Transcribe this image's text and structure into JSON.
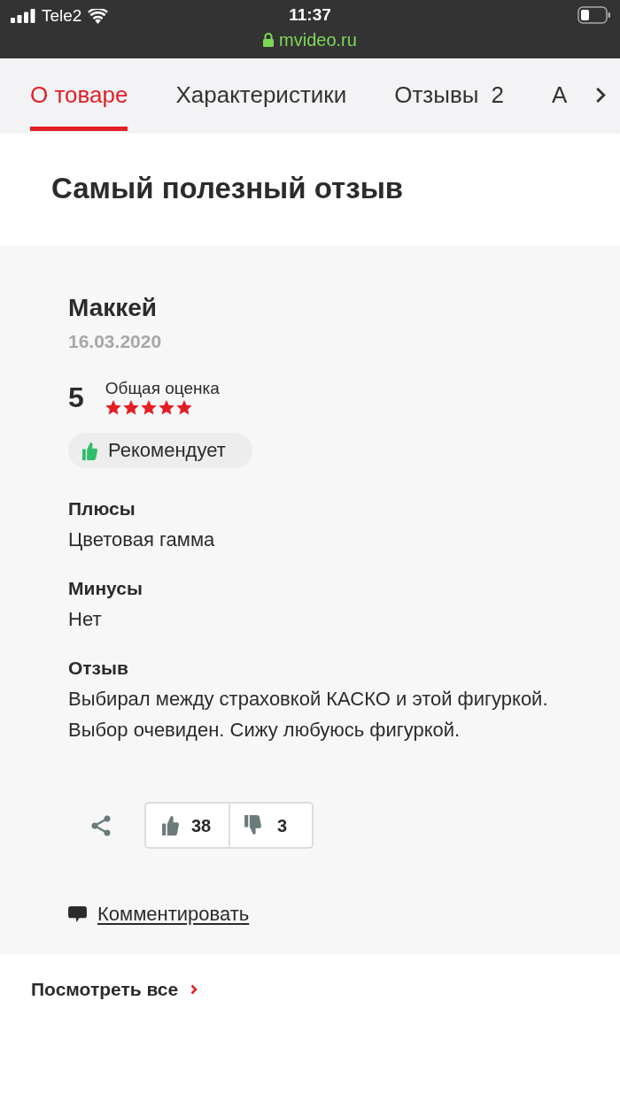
{
  "status_bar": {
    "carrier": "Tele2",
    "time": "11:37",
    "url": "mvideo.ru"
  },
  "tabs": [
    {
      "label": "О товаре",
      "selected": true
    },
    {
      "label": "Характеристики",
      "selected": false
    },
    {
      "label": "Отзывы",
      "count": "2",
      "selected": false
    },
    {
      "label": "А",
      "selected": false
    }
  ],
  "section_title": "Самый полезный отзыв",
  "review": {
    "author": "Маккей",
    "date": "16.03.2020",
    "rating": "5",
    "rating_label": "Общая оценка",
    "stars": 5,
    "recommendation": "Рекомендует",
    "sections": [
      {
        "title": "Плюсы",
        "text": "Цветовая гамма"
      },
      {
        "title": "Минусы",
        "text": "Нет"
      },
      {
        "title": "Отзыв",
        "text": "Выбирал между страховкой КАСКО и этой фигуркой. Выбор очевиден. Сижу любуюсь фигуркой."
      }
    ],
    "likes": "38",
    "dislikes": "3",
    "comment_link": "Комментировать"
  },
  "view_all": "Посмотреть все"
}
